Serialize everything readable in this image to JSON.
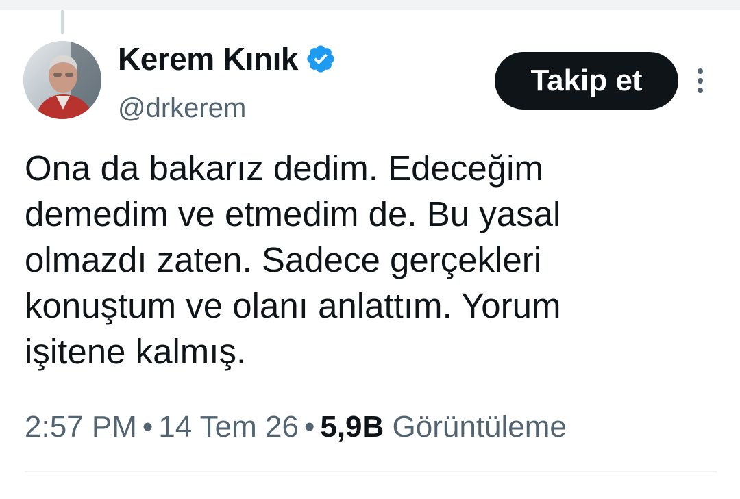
{
  "tweet": {
    "author": {
      "display_name": "Kerem Kınık",
      "handle": "@drkerem",
      "verified": true,
      "avatar_icon": "profile-photo"
    },
    "follow_label": "Takip et",
    "more_icon": "three-dots-vertical",
    "text_lines": [
      "Ona da bakarız dedim. Edeceğim",
      "demedim ve etmedim de. Bu yasal",
      "olmazdı zaten. Sadece gerçekleri",
      "konuştum ve olanı anlattım. Yorum",
      "işitene kalmış."
    ],
    "meta": {
      "time": "2:57 PM",
      "separator": "•",
      "date": "14 Tem 26",
      "views_count": "5,9B",
      "views_label": "Görüntüleme"
    }
  },
  "colors": {
    "text_primary": "#0f1419",
    "text_secondary": "#536471",
    "verified_blue": "#1d9bf0",
    "button_bg": "#0f1419",
    "button_text": "#ffffff"
  }
}
